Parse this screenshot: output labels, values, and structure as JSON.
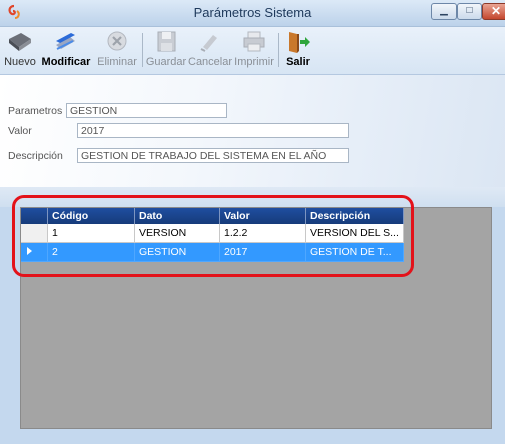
{
  "window": {
    "title": "Parámetros Sistema"
  },
  "toolbar": {
    "items": [
      {
        "label": "Nuevo",
        "icon": "book-icon",
        "enabled": true
      },
      {
        "label": "Modificar",
        "icon": "pencil-icon",
        "enabled": true
      },
      {
        "label": "Eliminar",
        "icon": "delete-icon",
        "enabled": false
      },
      {
        "label": "Guardar",
        "icon": "floppy-disk-icon",
        "enabled": false
      },
      {
        "label": "Cancelar",
        "icon": "cancel-icon",
        "enabled": false
      },
      {
        "label": "Imprimir",
        "icon": "printer-icon",
        "enabled": false
      },
      {
        "label": "Salir",
        "icon": "exit-door-icon",
        "enabled": true
      }
    ]
  },
  "form": {
    "parametros": {
      "label": "Parametros",
      "value": "GESTION"
    },
    "valor": {
      "label": "Valor",
      "value": "2017"
    },
    "descripcion": {
      "label": "Descripción",
      "value": "GESTION DE TRABAJO DEL SISTEMA EN EL AÑO"
    }
  },
  "grid": {
    "columns": [
      "Código",
      "Dato",
      "Valor",
      "Descripción"
    ],
    "rows": [
      {
        "codigo": "1",
        "dato": "VERSION",
        "valor": "1.2.2",
        "descripcion": "VERSION DEL S...",
        "selected": false
      },
      {
        "codigo": "2",
        "dato": "GESTION",
        "valor": "2017",
        "descripcion": "GESTION DE T...",
        "selected": true
      }
    ]
  },
  "colors": {
    "selection": "#3399ff",
    "header": "#1f4ea0",
    "highlight": "#e3121a"
  }
}
